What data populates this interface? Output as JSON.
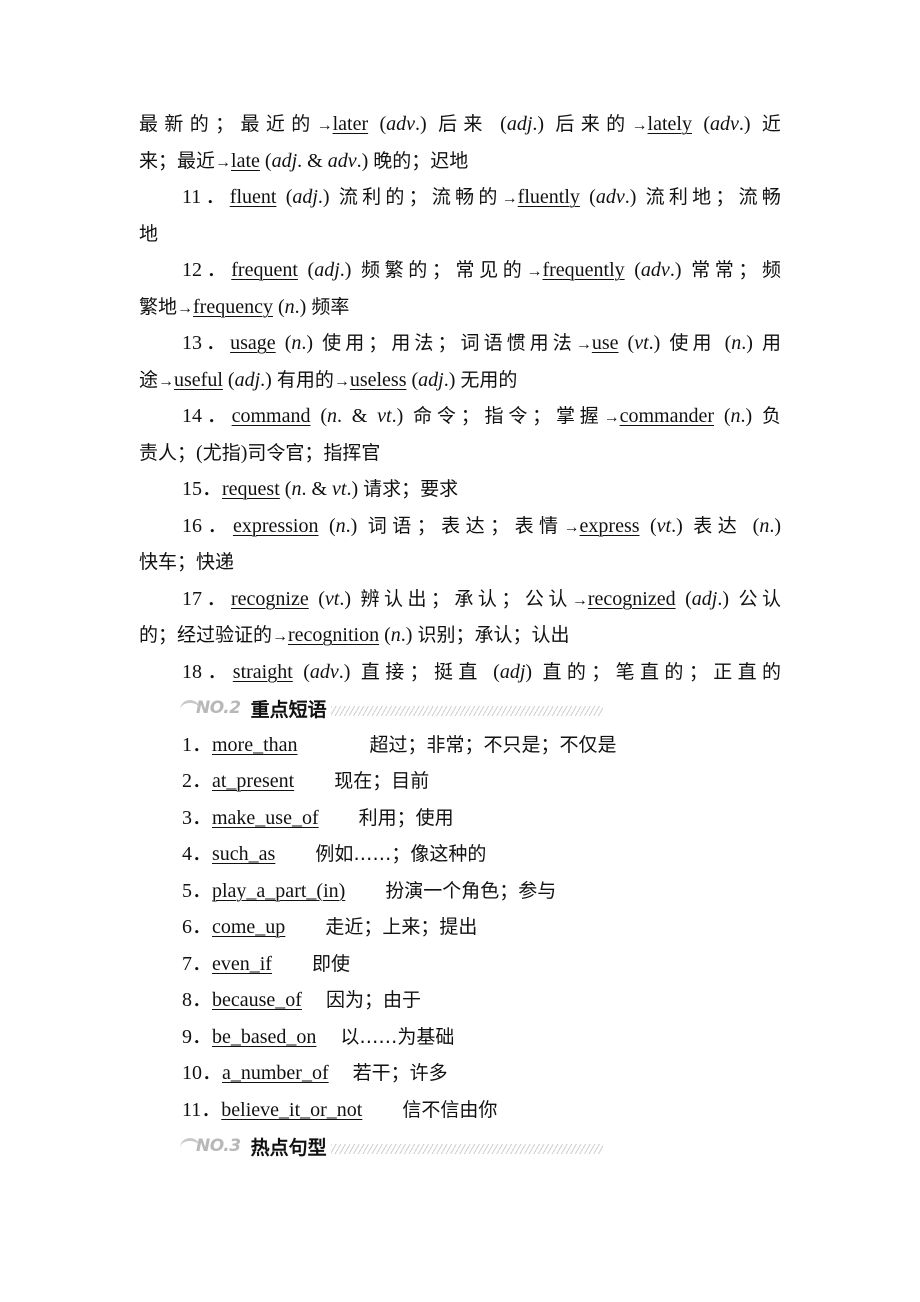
{
  "vocab_lines": [
    {
      "parts": [
        {
          "t": "最新的；最近的",
          "k": "cn"
        },
        {
          "t": "→",
          "k": "arrow"
        },
        {
          "t": "later",
          "k": "u"
        },
        {
          "t": " (",
          "k": ""
        },
        {
          "t": "adv",
          "k": "i"
        },
        {
          "t": ".) ",
          "k": ""
        },
        {
          "t": "后来",
          "k": "cn"
        },
        {
          "t": "  (",
          "k": ""
        },
        {
          "t": "adj",
          "k": "i"
        },
        {
          "t": ".) ",
          "k": ""
        },
        {
          "t": "后来的",
          "k": "cn"
        },
        {
          "t": "→",
          "k": "arrow"
        },
        {
          "t": "lately",
          "k": "u"
        },
        {
          "t": " (",
          "k": ""
        },
        {
          "t": "adv",
          "k": "i"
        },
        {
          "t": ".) ",
          "k": ""
        },
        {
          "t": "近",
          "k": "cn"
        }
      ],
      "indent": false,
      "justify": true
    },
    {
      "parts": [
        {
          "t": "来；最近",
          "k": "cn"
        },
        {
          "t": "→",
          "k": "arrow"
        },
        {
          "t": "late",
          "k": "u"
        },
        {
          "t": " (",
          "k": ""
        },
        {
          "t": "adj",
          "k": "i"
        },
        {
          "t": ". & ",
          "k": ""
        },
        {
          "t": "adv",
          "k": "i"
        },
        {
          "t": ".) ",
          "k": ""
        },
        {
          "t": "晚的；迟地",
          "k": "cn"
        }
      ],
      "indent": false,
      "justify": false
    },
    {
      "parts": [
        {
          "t": "11．",
          "k": ""
        },
        {
          "t": "fluent",
          "k": "u"
        },
        {
          "t": " (",
          "k": ""
        },
        {
          "t": "adj",
          "k": "i"
        },
        {
          "t": ".) ",
          "k": ""
        },
        {
          "t": "流利的；流畅的",
          "k": "cn"
        },
        {
          "t": "→",
          "k": "arrow"
        },
        {
          "t": "fluently",
          "k": "u"
        },
        {
          "t": " (",
          "k": ""
        },
        {
          "t": "adv",
          "k": "i"
        },
        {
          "t": ".) ",
          "k": ""
        },
        {
          "t": "流利地；流畅",
          "k": "cn"
        }
      ],
      "indent": true,
      "justify": true
    },
    {
      "parts": [
        {
          "t": "地",
          "k": "cn"
        }
      ],
      "indent": false,
      "justify": false
    },
    {
      "parts": [
        {
          "t": "12．",
          "k": ""
        },
        {
          "t": "frequent",
          "k": "u"
        },
        {
          "t": " (",
          "k": ""
        },
        {
          "t": "adj",
          "k": "i"
        },
        {
          "t": ".) ",
          "k": ""
        },
        {
          "t": "频繁的；常见的",
          "k": "cn"
        },
        {
          "t": "→",
          "k": "arrow"
        },
        {
          "t": "frequently",
          "k": "u"
        },
        {
          "t": " (",
          "k": ""
        },
        {
          "t": "adv",
          "k": "i"
        },
        {
          "t": ".) ",
          "k": ""
        },
        {
          "t": "常常；频",
          "k": "cn"
        }
      ],
      "indent": true,
      "justify": true
    },
    {
      "parts": [
        {
          "t": "繁地",
          "k": "cn"
        },
        {
          "t": "→",
          "k": "arrow"
        },
        {
          "t": "frequency",
          "k": "u"
        },
        {
          "t": " (",
          "k": ""
        },
        {
          "t": "n",
          "k": "i"
        },
        {
          "t": ".) ",
          "k": ""
        },
        {
          "t": "频率",
          "k": "cn"
        }
      ],
      "indent": false,
      "justify": false
    },
    {
      "parts": [
        {
          "t": "13．",
          "k": ""
        },
        {
          "t": "usage",
          "k": "u"
        },
        {
          "t": " (",
          "k": ""
        },
        {
          "t": "n",
          "k": "i"
        },
        {
          "t": ".) ",
          "k": ""
        },
        {
          "t": "使用；用法；词语惯用法",
          "k": "cn"
        },
        {
          "t": "→",
          "k": "arrow"
        },
        {
          "t": "use",
          "k": "u"
        },
        {
          "t": " (",
          "k": ""
        },
        {
          "t": "vt",
          "k": "i"
        },
        {
          "t": ".) ",
          "k": ""
        },
        {
          "t": "使用",
          "k": "cn"
        },
        {
          "t": "  (",
          "k": ""
        },
        {
          "t": "n",
          "k": "i"
        },
        {
          "t": ".) ",
          "k": ""
        },
        {
          "t": "用",
          "k": "cn"
        }
      ],
      "indent": true,
      "justify": true
    },
    {
      "parts": [
        {
          "t": "途",
          "k": "cn"
        },
        {
          "t": "→",
          "k": "arrow"
        },
        {
          "t": "useful",
          "k": "u"
        },
        {
          "t": " (",
          "k": ""
        },
        {
          "t": "adj",
          "k": "i"
        },
        {
          "t": ".) ",
          "k": ""
        },
        {
          "t": "有用的",
          "k": "cn"
        },
        {
          "t": "→",
          "k": "arrow"
        },
        {
          "t": "useless",
          "k": "u"
        },
        {
          "t": " (",
          "k": ""
        },
        {
          "t": "adj",
          "k": "i"
        },
        {
          "t": ".) ",
          "k": ""
        },
        {
          "t": "无用的",
          "k": "cn"
        }
      ],
      "indent": false,
      "justify": false
    },
    {
      "parts": [
        {
          "t": "14．",
          "k": ""
        },
        {
          "t": "command",
          "k": "u"
        },
        {
          "t": " (",
          "k": ""
        },
        {
          "t": "n",
          "k": "i"
        },
        {
          "t": ". & ",
          "k": ""
        },
        {
          "t": "vt",
          "k": "i"
        },
        {
          "t": ".) ",
          "k": ""
        },
        {
          "t": "命令；指令；掌握",
          "k": "cn"
        },
        {
          "t": "→",
          "k": "arrow"
        },
        {
          "t": "commander",
          "k": "u"
        },
        {
          "t": " (",
          "k": ""
        },
        {
          "t": "n",
          "k": "i"
        },
        {
          "t": ".) ",
          "k": ""
        },
        {
          "t": "负",
          "k": "cn"
        }
      ],
      "indent": true,
      "justify": true
    },
    {
      "parts": [
        {
          "t": "责人；",
          "k": "cn"
        },
        {
          "t": "(",
          "k": ""
        },
        {
          "t": "尤指",
          "k": "cn"
        },
        {
          "t": ")",
          "k": ""
        },
        {
          "t": "司令官；指挥官",
          "k": "cn"
        }
      ],
      "indent": false,
      "justify": false
    },
    {
      "parts": [
        {
          "t": "15．",
          "k": ""
        },
        {
          "t": "request",
          "k": "u"
        },
        {
          "t": " (",
          "k": ""
        },
        {
          "t": "n",
          "k": "i"
        },
        {
          "t": ". & ",
          "k": ""
        },
        {
          "t": "vt",
          "k": "i"
        },
        {
          "t": ".) ",
          "k": ""
        },
        {
          "t": "请求；要求",
          "k": "cn"
        }
      ],
      "indent": true,
      "justify": false
    },
    {
      "parts": [
        {
          "t": "16．",
          "k": ""
        },
        {
          "t": "expression",
          "k": "u"
        },
        {
          "t": " (",
          "k": ""
        },
        {
          "t": "n",
          "k": "i"
        },
        {
          "t": ".) ",
          "k": ""
        },
        {
          "t": "词语；表达；表情",
          "k": "cn"
        },
        {
          "t": "→",
          "k": "arrow"
        },
        {
          "t": "express",
          "k": "u"
        },
        {
          "t": " (",
          "k": ""
        },
        {
          "t": "vt",
          "k": "i"
        },
        {
          "t": ".) ",
          "k": ""
        },
        {
          "t": "表达",
          "k": "cn"
        },
        {
          "t": "  (",
          "k": ""
        },
        {
          "t": "n",
          "k": "i"
        },
        {
          "t": ".)",
          "k": ""
        }
      ],
      "indent": true,
      "justify": true
    },
    {
      "parts": [
        {
          "t": "快车；快递",
          "k": "cn"
        }
      ],
      "indent": false,
      "justify": false
    },
    {
      "parts": [
        {
          "t": "17．",
          "k": ""
        },
        {
          "t": "recognize",
          "k": "u"
        },
        {
          "t": " (",
          "k": ""
        },
        {
          "t": "vt",
          "k": "i"
        },
        {
          "t": ".) ",
          "k": ""
        },
        {
          "t": "辨认出；承认；公认",
          "k": "cn"
        },
        {
          "t": "→",
          "k": "arrow"
        },
        {
          "t": "recognized",
          "k": "u"
        },
        {
          "t": " (",
          "k": ""
        },
        {
          "t": "adj",
          "k": "i"
        },
        {
          "t": ".) ",
          "k": ""
        },
        {
          "t": "公认",
          "k": "cn"
        }
      ],
      "indent": true,
      "justify": true
    },
    {
      "parts": [
        {
          "t": "的；经过验证的",
          "k": "cn"
        },
        {
          "t": "→",
          "k": "arrow"
        },
        {
          "t": "recognition",
          "k": "u"
        },
        {
          "t": " (",
          "k": ""
        },
        {
          "t": "n",
          "k": "i"
        },
        {
          "t": ".) ",
          "k": ""
        },
        {
          "t": "识别；承认；认出",
          "k": "cn"
        }
      ],
      "indent": false,
      "justify": false
    },
    {
      "parts": [
        {
          "t": "18．",
          "k": ""
        },
        {
          "t": "straight",
          "k": "u"
        },
        {
          "t": " (",
          "k": ""
        },
        {
          "t": "adv",
          "k": "i"
        },
        {
          "t": ".) ",
          "k": ""
        },
        {
          "t": "直接；挺直",
          "k": "cn"
        },
        {
          "t": "  (",
          "k": ""
        },
        {
          "t": "adj",
          "k": "i"
        },
        {
          "t": ") ",
          "k": ""
        },
        {
          "t": "直的；笔直的；正直的",
          "k": "cn"
        }
      ],
      "indent": true,
      "justify": true
    }
  ],
  "section2": {
    "badge": "NO.2",
    "title": "重点短语"
  },
  "phrases": [
    {
      "num": "1．",
      "en": "more_than",
      "gap": 4,
      "cn": "超过；非常；不只是；不仅是"
    },
    {
      "num": "2．",
      "en": "at_present",
      "gap": 2,
      "cn": "现在；目前"
    },
    {
      "num": "3．",
      "en": "make_use_of",
      "gap": 2,
      "cn": "利用；使用"
    },
    {
      "num": "4．",
      "en": "such_as",
      "gap": 2,
      "cn": "例如……；像这种的"
    },
    {
      "num": "5．",
      "en": "play_a_part_(in)",
      "gap": 2,
      "cn": "扮演一个角色；参与"
    },
    {
      "num": "6．",
      "en": "come_up",
      "gap": 2,
      "cn": "走近；上来；提出"
    },
    {
      "num": "7．",
      "en": "even_if",
      "gap": 2,
      "cn": "即使"
    },
    {
      "num": "8．",
      "en": "because_of",
      "gap": 1,
      "cn": "因为；由于"
    },
    {
      "num": "9．",
      "en": "be_based_on",
      "gap": 1,
      "cn": "以……为基础"
    },
    {
      "num": "10．",
      "en": "a_number_of",
      "gap": 1,
      "cn": "若干；许多"
    },
    {
      "num": "11．",
      "en": "believe_it_or_not",
      "gap": 2,
      "cn": "信不信由你"
    }
  ],
  "section3": {
    "badge": "NO.3",
    "title": "热点句型"
  }
}
